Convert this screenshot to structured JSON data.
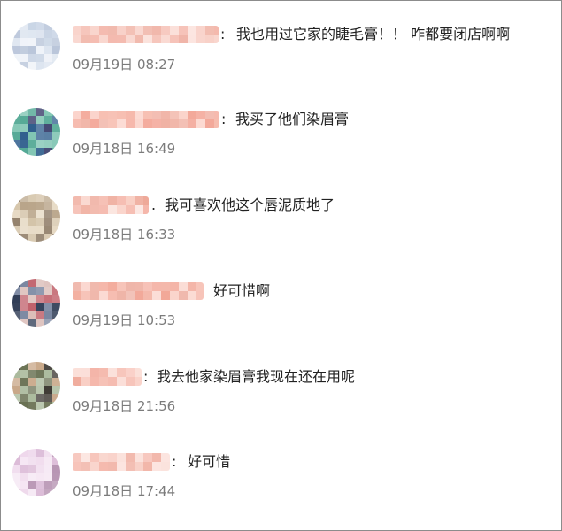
{
  "comments": [
    {
      "separator": ":",
      "text": "我也用过它家的睫毛膏！！ 咋都要闭店啊啊",
      "time": "09月19日 08:27",
      "avatar_colors": [
        "#c7d3e4",
        "#dce4ef",
        "#eef2f8",
        "#b6c3d8"
      ],
      "name_colors": [
        "#f4b9ad",
        "#f8cfc6",
        "#efaea0",
        "#fbe0da"
      ]
    },
    {
      "separator": ":",
      "text": "我买了他们染眉膏",
      "time": "09月18日 16:49",
      "avatar_colors": [
        "#4aa48f",
        "#2e5d8c",
        "#7cc3b0",
        "#3b3f6d"
      ],
      "name_colors": [
        "#f6b8aa",
        "#f3a596",
        "#fbd3ca",
        "#f0b0a2"
      ]
    },
    {
      "separator": ".",
      "text": "我可喜欢他这个唇泥质地了",
      "time": "09月18日 16:33",
      "avatar_colors": [
        "#b9a58a",
        "#d3c2a6",
        "#8f7c66",
        "#e6d9c3"
      ],
      "name_colors": [
        "#f4b3a6",
        "#f9cdc2",
        "#eea898",
        "#fbe2dc"
      ]
    },
    {
      "separator": "",
      "text": "好可惜啊",
      "time": "09月19日 10:53",
      "avatar_colors": [
        "#2f3c55",
        "#c0606a",
        "#7986a0",
        "#d9b9b4"
      ],
      "name_colors": [
        "#f5b6a9",
        "#f1a392",
        "#fad2c9",
        "#eeb0a3"
      ]
    },
    {
      "separator": ":",
      "text": "我去他家染眉膏我现在还在用呢",
      "time": "09月18日 21:56",
      "avatar_colors": [
        "#6a7254",
        "#c9a889",
        "#3e3a34",
        "#a8b89a"
      ],
      "name_colors": [
        "#f4b4a7",
        "#f9cbc1",
        "#efa797",
        "#fbded7"
      ]
    },
    {
      "separator": ":",
      "text": "好可惜",
      "time": "09月18日 17:44",
      "avatar_colors": [
        "#dcbcd8",
        "#eed7eb",
        "#b896b4",
        "#f5e6f3"
      ],
      "name_colors": [
        "#f5b9ad",
        "#f8cfc6",
        "#f0aea0",
        "#fbe1db"
      ]
    }
  ]
}
